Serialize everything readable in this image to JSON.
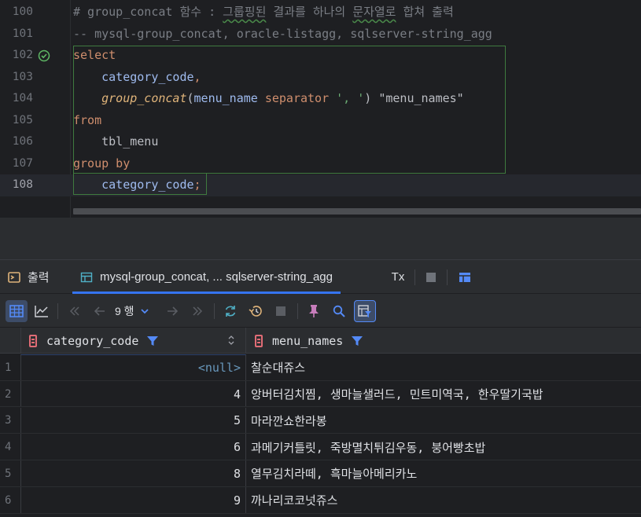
{
  "editor": {
    "lines": [
      {
        "num": "100",
        "parts": [
          {
            "t": "# group_concat ",
            "c": "cmt"
          },
          {
            "t": "함수 : ",
            "c": "cmt"
          },
          {
            "t": "그룹핑된",
            "c": "cmt wavy"
          },
          {
            "t": " 결과를 하나의 ",
            "c": "cmt"
          },
          {
            "t": "문자열로",
            "c": "cmt wavy"
          },
          {
            "t": " 합쳐 출력",
            "c": "cmt"
          }
        ]
      },
      {
        "num": "101",
        "parts": [
          {
            "t": "-- mysql-group_concat, oracle-listagg, sqlserver-string_agg",
            "c": "cmt"
          }
        ]
      },
      {
        "num": "102",
        "parts": [
          {
            "t": "select",
            "c": "kw"
          }
        ],
        "run_icon": true
      },
      {
        "num": "103",
        "parts": [
          {
            "t": "    category_code",
            "c": "col"
          },
          {
            "t": ",",
            "c": "kw"
          }
        ]
      },
      {
        "num": "104",
        "parts": [
          {
            "t": "    ",
            "c": "plain"
          },
          {
            "t": "group_concat",
            "c": "fn"
          },
          {
            "t": "(",
            "c": "plain"
          },
          {
            "t": "menu_name ",
            "c": "col"
          },
          {
            "t": "separator ",
            "c": "kw"
          },
          {
            "t": "', '",
            "c": "str"
          },
          {
            "t": ") \"menu_names\"",
            "c": "plain"
          }
        ]
      },
      {
        "num": "105",
        "parts": [
          {
            "t": "from",
            "c": "kw"
          }
        ]
      },
      {
        "num": "106",
        "parts": [
          {
            "t": "    tbl_menu",
            "c": "plain"
          }
        ]
      },
      {
        "num": "107",
        "parts": [
          {
            "t": "group by",
            "c": "kw"
          }
        ]
      },
      {
        "num": "108",
        "parts": [
          {
            "t": "    category_code",
            "c": "col"
          },
          {
            "t": ";",
            "c": "kw"
          }
        ],
        "current": true
      }
    ]
  },
  "tabs": {
    "output_label": "출력",
    "result_label": "mysql-group_concat, ... sqlserver-string_agg",
    "tx_label": "Tx"
  },
  "toolbar": {
    "row_count": "9 행"
  },
  "grid": {
    "columns": [
      "category_code",
      "menu_names"
    ],
    "rows": [
      {
        "num": "1",
        "code": "<null>",
        "names": "찰순대쥬스"
      },
      {
        "num": "2",
        "code": "4",
        "names": "앙버터김치찜, 생마늘샐러드, 민트미역국, 한우딸기국밥"
      },
      {
        "num": "3",
        "code": "5",
        "names": "마라깐쇼한라봉"
      },
      {
        "num": "4",
        "code": "6",
        "names": "과메기커틀릿, 죽방멸치튀김우동, 붕어빵초밥"
      },
      {
        "num": "5",
        "code": "8",
        "names": "열무김치라떼, 흑마늘아메리카노"
      },
      {
        "num": "6",
        "code": "9",
        "names": "까나리코코넛쥬스"
      }
    ]
  }
}
